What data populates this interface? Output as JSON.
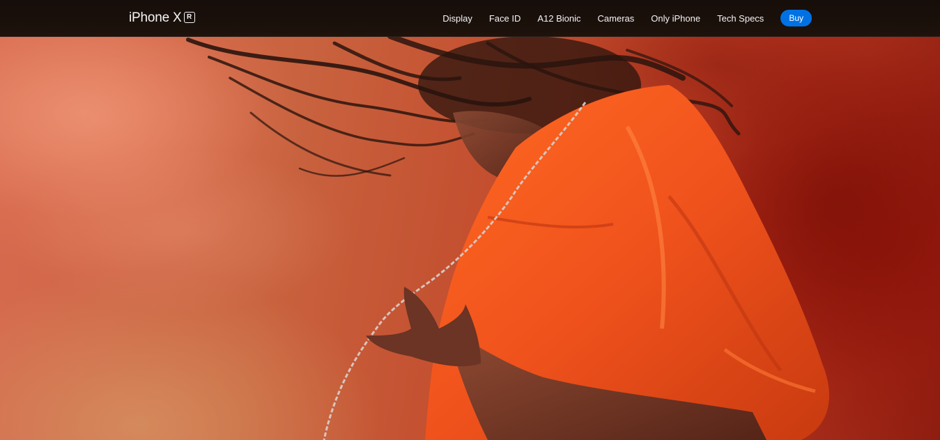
{
  "nav": {
    "brand": "iPhone X",
    "brand_badge": "R",
    "items": [
      {
        "label": "Display"
      },
      {
        "label": "Face ID"
      },
      {
        "label": "A12 Bionic"
      },
      {
        "label": "Cameras"
      },
      {
        "label": "Only iPhone"
      },
      {
        "label": "Tech Specs"
      }
    ],
    "buy_label": "Buy"
  },
  "colors": {
    "buy_button": "#0071e3",
    "nav_background": "#1e120c",
    "shirt": "#f0521c",
    "smoke": "#c9633f"
  }
}
